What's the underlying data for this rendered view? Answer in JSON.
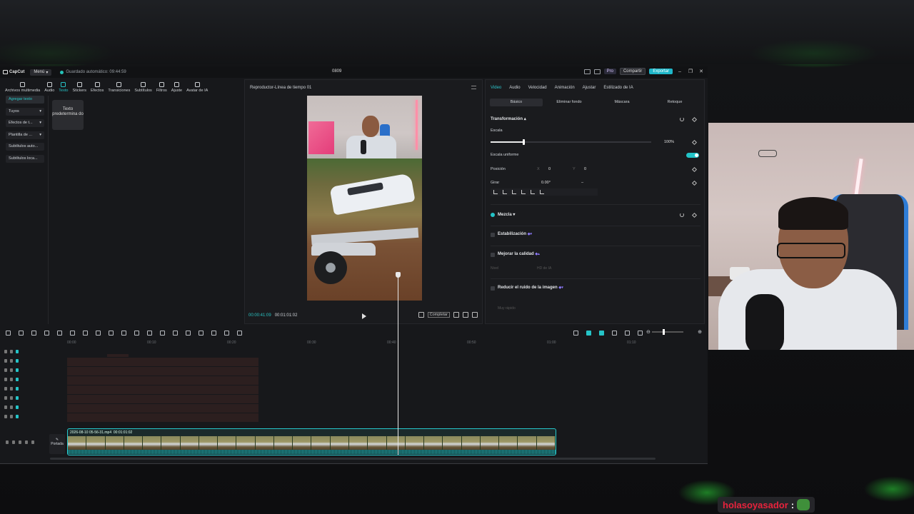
{
  "titlebar": {
    "app_name": "CapCut",
    "menu_label": "Menú",
    "autosave": "Guardado automático: 09:44:59",
    "project_name": "0809",
    "pro_label": "Pro",
    "share_label": "Compartir",
    "export_label": "Exportar"
  },
  "tools": [
    {
      "label": "Archivos multimedia"
    },
    {
      "label": "Audio"
    },
    {
      "label": "Texto"
    },
    {
      "label": "Stickers"
    },
    {
      "label": "Efectos"
    },
    {
      "label": "Transiciones"
    },
    {
      "label": "Subtítulos"
    },
    {
      "label": "Filtros"
    },
    {
      "label": "Ajuste"
    },
    {
      "label": "Avatar de IA"
    }
  ],
  "left_panel": {
    "items": [
      "Agregar texto",
      "Tuyos",
      "Efectos de t...",
      "Plantilla de ...",
      "Subtítulos auto...",
      "Subtítulos loca..."
    ],
    "card_label": "Texto predetermina do"
  },
  "player": {
    "title": "Reproductor-Línea de tiempo 01",
    "current_time": "00:00:41:09",
    "total_time": "00:01:01:02",
    "ratio_label": "Completar"
  },
  "inspector": {
    "tabs": [
      "Video",
      "Audio",
      "Velocidad",
      "Animación",
      "Ajustar",
      "Estilizado de IA"
    ],
    "subtabs": [
      "Básico",
      "Eliminar fondo",
      "Máscara",
      "Retoque"
    ],
    "transform_title": "Transformación",
    "scale_label": "Escala",
    "scale_value": "100%",
    "scale_level": 0.2,
    "uniform_label": "Escala uniforme",
    "position_label": "Posición",
    "pos_x_label": "X",
    "pos_x": "0",
    "pos_y_label": "Y",
    "pos_y": "0",
    "rotate_label": "Girar",
    "rotate_value": "0.00°",
    "rotate_extra": "–",
    "blend_label": "Mezcla",
    "stabilize_label": "Estabilización",
    "quality_label": "Mejorar la calidad",
    "quality_mode_label": "Nivel",
    "quality_mode_value": "HD de IA",
    "denoise_label": "Reducir el ruido de la imagen",
    "speed_label": "Muy rápido"
  },
  "timeline": {
    "ruler": [
      "00:00",
      "00:10",
      "00:20",
      "00:30",
      "00:40",
      "00:50",
      "01:00",
      "01:10"
    ],
    "clip_name": "2026-08-10 05-56-31.mp4",
    "clip_duration": "00:01:01:02",
    "cover_label": "Portada"
  },
  "chat": {
    "username": "holasoyasador",
    "colon": ":"
  },
  "colors": {
    "accent": "#25c4c8",
    "chat_user": "#e8223c"
  }
}
